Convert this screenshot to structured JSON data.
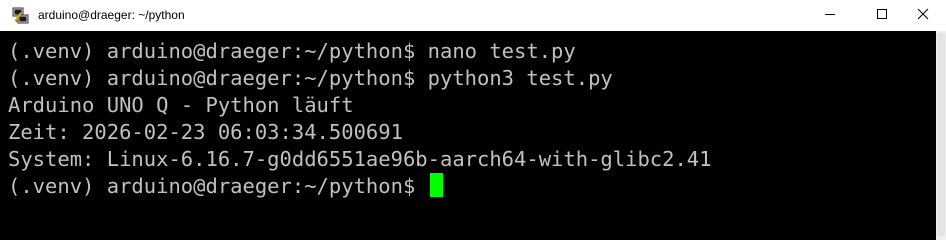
{
  "window": {
    "title": "arduino@draeger: ~/python",
    "app_icon": "putty-terminal-icon",
    "controls": {
      "minimize_icon": "minimize-icon",
      "maximize_icon": "maximize-icon",
      "close_icon": "close-icon"
    }
  },
  "terminal": {
    "lines": [
      "(.venv) arduino@draeger:~/python$ nano test.py",
      "(.venv) arduino@draeger:~/python$ python3 test.py",
      "Arduino UNO Q - Python läuft",
      "Zeit: 2026-02-23 06:03:34.500691",
      "System: Linux-6.16.7-g0dd6551ae96b-aarch64-with-glibc2.41",
      "(.venv) arduino@draeger:~/python$ "
    ],
    "text_color": "#c0c0c0",
    "background_color": "#000000",
    "cursor_color": "#00ff00"
  }
}
